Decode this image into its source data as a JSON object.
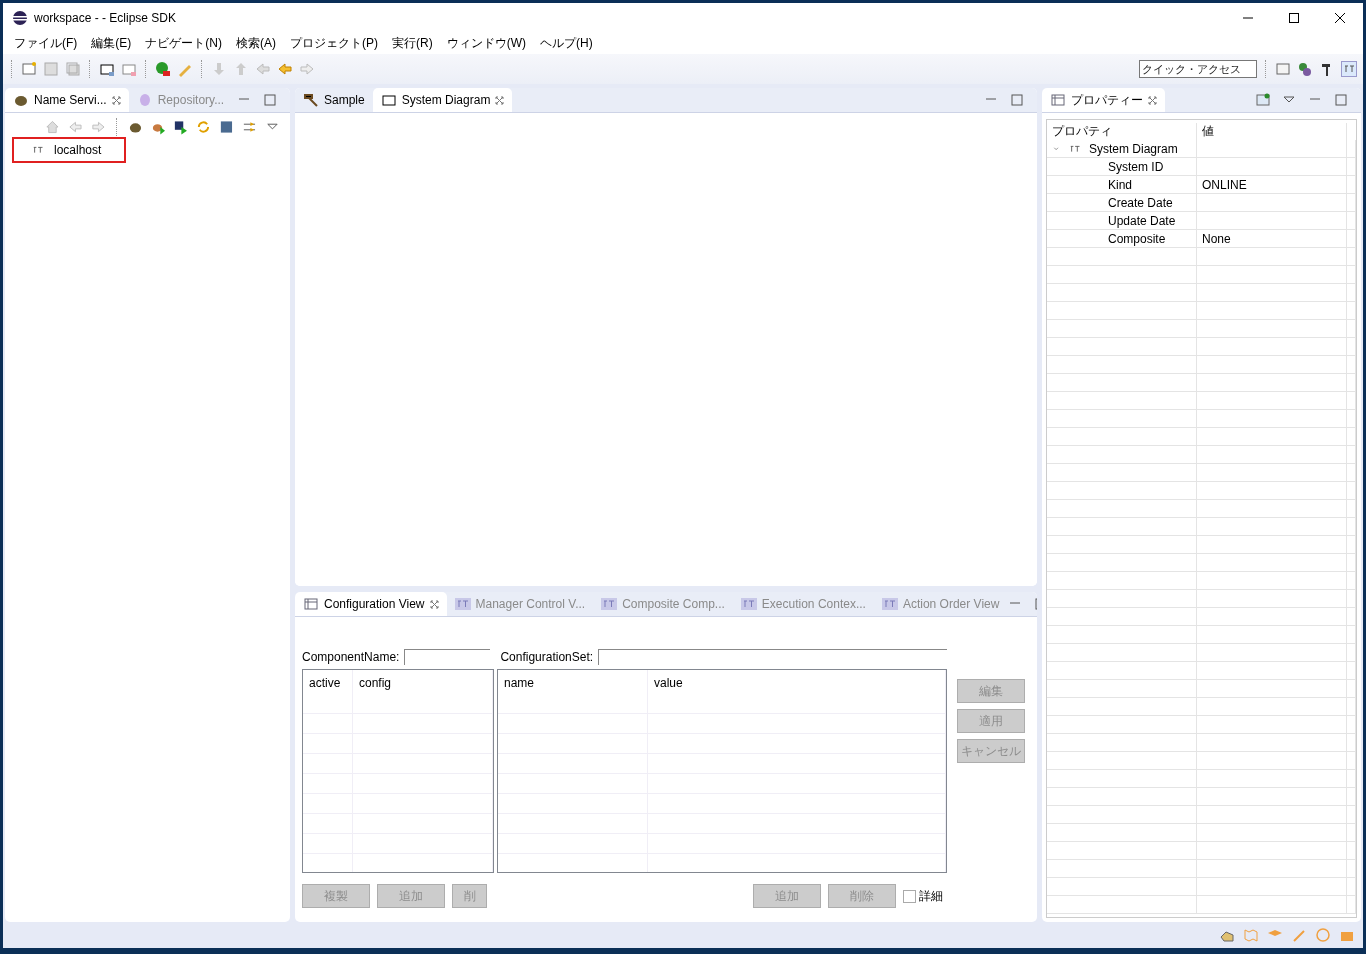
{
  "window": {
    "title": "workspace -  - Eclipse SDK"
  },
  "menu": [
    "ファイル(F)",
    "編集(E)",
    "ナビゲート(N)",
    "検索(A)",
    "プロジェクト(P)",
    "実行(R)",
    "ウィンドウ(W)",
    "ヘルプ(H)"
  ],
  "quick_access": {
    "placeholder": "クイック・アクセス"
  },
  "left_panel": {
    "tabs": [
      {
        "label": "Name Servi...",
        "selected": true
      },
      {
        "label": "Repository...",
        "selected": false
      }
    ],
    "tree": [
      {
        "label": "localhost",
        "highlighted": true
      }
    ]
  },
  "editor": {
    "tabs": [
      {
        "label": "Sample",
        "selected": false
      },
      {
        "label": "System Diagram",
        "selected": true
      }
    ]
  },
  "bottom_panel": {
    "tabs": [
      {
        "label": "Configuration View",
        "selected": true
      },
      {
        "label": "Manager Control V...",
        "selected": false
      },
      {
        "label": "Composite Comp...",
        "selected": false
      },
      {
        "label": "Execution Contex...",
        "selected": false
      },
      {
        "label": "Action Order View",
        "selected": false
      }
    ],
    "component_name_label": "ComponentName:",
    "configuration_set_label": "ConfigurationSet:",
    "left_table": {
      "columns": [
        "active",
        "config"
      ]
    },
    "right_table": {
      "columns": [
        "name",
        "value"
      ]
    },
    "side_buttons": [
      {
        "label": "編集",
        "disabled": true
      },
      {
        "label": "適用",
        "disabled": true
      },
      {
        "label": "キャンセル",
        "disabled": true
      }
    ],
    "left_buttons": [
      {
        "label": "複製",
        "disabled": true
      },
      {
        "label": "追加",
        "disabled": true
      },
      {
        "label": "削",
        "disabled": true
      }
    ],
    "right_buttons": [
      {
        "label": "追加",
        "disabled": true
      },
      {
        "label": "削除",
        "disabled": true
      }
    ],
    "detail_checkbox": {
      "label": "詳細",
      "checked": false
    }
  },
  "properties": {
    "tab": {
      "label": "プロパティー",
      "selected": true
    },
    "columns": [
      "プロパティ",
      "値"
    ],
    "tree": [
      {
        "label": "System Diagram",
        "expanded": true,
        "children": [
          {
            "name": "System ID"
          },
          {
            "name": "Kind",
            "value": "ONLINE"
          },
          {
            "name": "Create Date"
          },
          {
            "name": "Update Date"
          },
          {
            "name": "Composite",
            "value": "None"
          }
        ]
      }
    ]
  }
}
